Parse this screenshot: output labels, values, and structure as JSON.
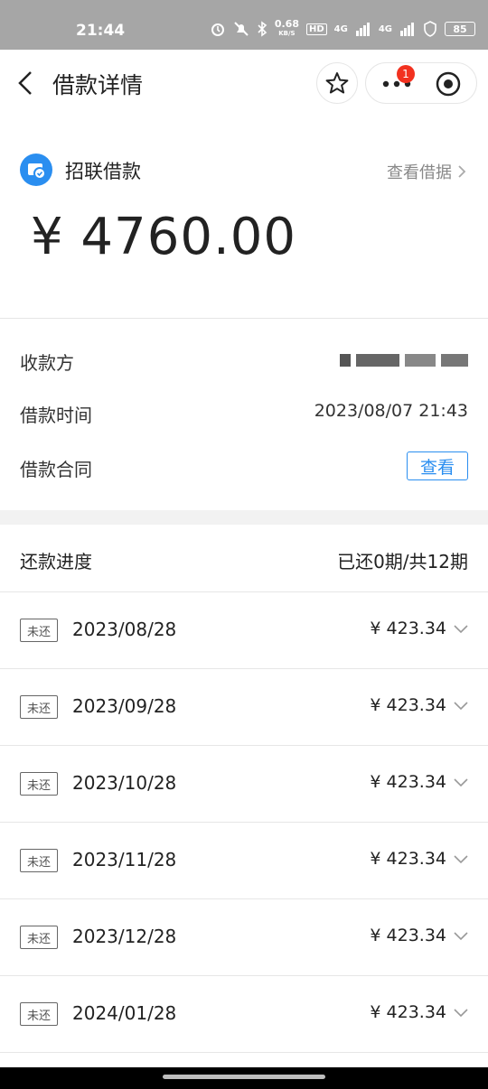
{
  "status": {
    "time": "21:44",
    "speed_value": "0.68",
    "speed_unit": "KB/S",
    "hd_label": "HD",
    "net1": "4G",
    "net2": "4G",
    "battery": "85"
  },
  "nav": {
    "title": "借款详情",
    "badge_count": "1"
  },
  "loan": {
    "name": "招联借款",
    "view_receipt": "查看借据",
    "amount": "¥ 4760.00"
  },
  "info": {
    "payee_label": "收款方",
    "time_label": "借款时间",
    "time_value": "2023/08/07 21:43",
    "contract_label": "借款合同",
    "contract_button": "查看"
  },
  "progress": {
    "label": "还款进度",
    "value": "已还0期/共12期"
  },
  "installments": [
    {
      "status": "未还",
      "date": "2023/08/28",
      "amount": "¥ 423.34"
    },
    {
      "status": "未还",
      "date": "2023/09/28",
      "amount": "¥ 423.34"
    },
    {
      "status": "未还",
      "date": "2023/10/28",
      "amount": "¥ 423.34"
    },
    {
      "status": "未还",
      "date": "2023/11/28",
      "amount": "¥ 423.34"
    },
    {
      "status": "未还",
      "date": "2023/12/28",
      "amount": "¥ 423.34"
    },
    {
      "status": "未还",
      "date": "2024/01/28",
      "amount": "¥ 423.34"
    }
  ],
  "colors": {
    "accent": "#2a8ef0",
    "badge": "#f2311f",
    "statusbar": "#a6a6a6"
  }
}
